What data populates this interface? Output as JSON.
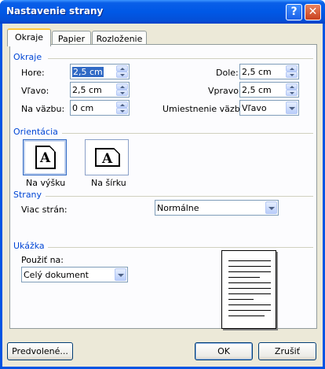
{
  "window": {
    "title": "Nastavenie strany",
    "help_label": "?",
    "close_label": "✕"
  },
  "tabs": [
    {
      "label": "Okraje",
      "active": true
    },
    {
      "label": "Papier",
      "active": false
    },
    {
      "label": "Rozloženie",
      "active": false
    }
  ],
  "margins": {
    "group_label": "Okraje",
    "top": {
      "label": "Hore:",
      "value": "2,5 cm"
    },
    "bottom": {
      "label": "Dole:",
      "value": "2,5 cm"
    },
    "left": {
      "label": "Vľavo:",
      "value": "2,5 cm"
    },
    "right": {
      "label": "Vpravo:",
      "value": "2,5 cm"
    },
    "gutter": {
      "label": "Na väzbu:",
      "value": "0 cm"
    },
    "gutter_position": {
      "label": "Umiestnenie väzby:",
      "value": "Vľavo"
    }
  },
  "orientation": {
    "group_label": "Orientácia",
    "portrait": {
      "label": "Na výšku",
      "icon_letter": "A",
      "selected": true
    },
    "landscape": {
      "label": "Na šírku",
      "icon_letter": "A",
      "selected": false
    }
  },
  "pages": {
    "group_label": "Strany",
    "multiple_label": "Viac strán:",
    "multiple_value": "Normálne"
  },
  "preview": {
    "group_label": "Ukážka",
    "apply_label": "Použiť na:",
    "apply_value": "Celý dokument"
  },
  "buttons": {
    "default": "Predvolené...",
    "ok": "OK",
    "cancel": "Zrušiť"
  }
}
